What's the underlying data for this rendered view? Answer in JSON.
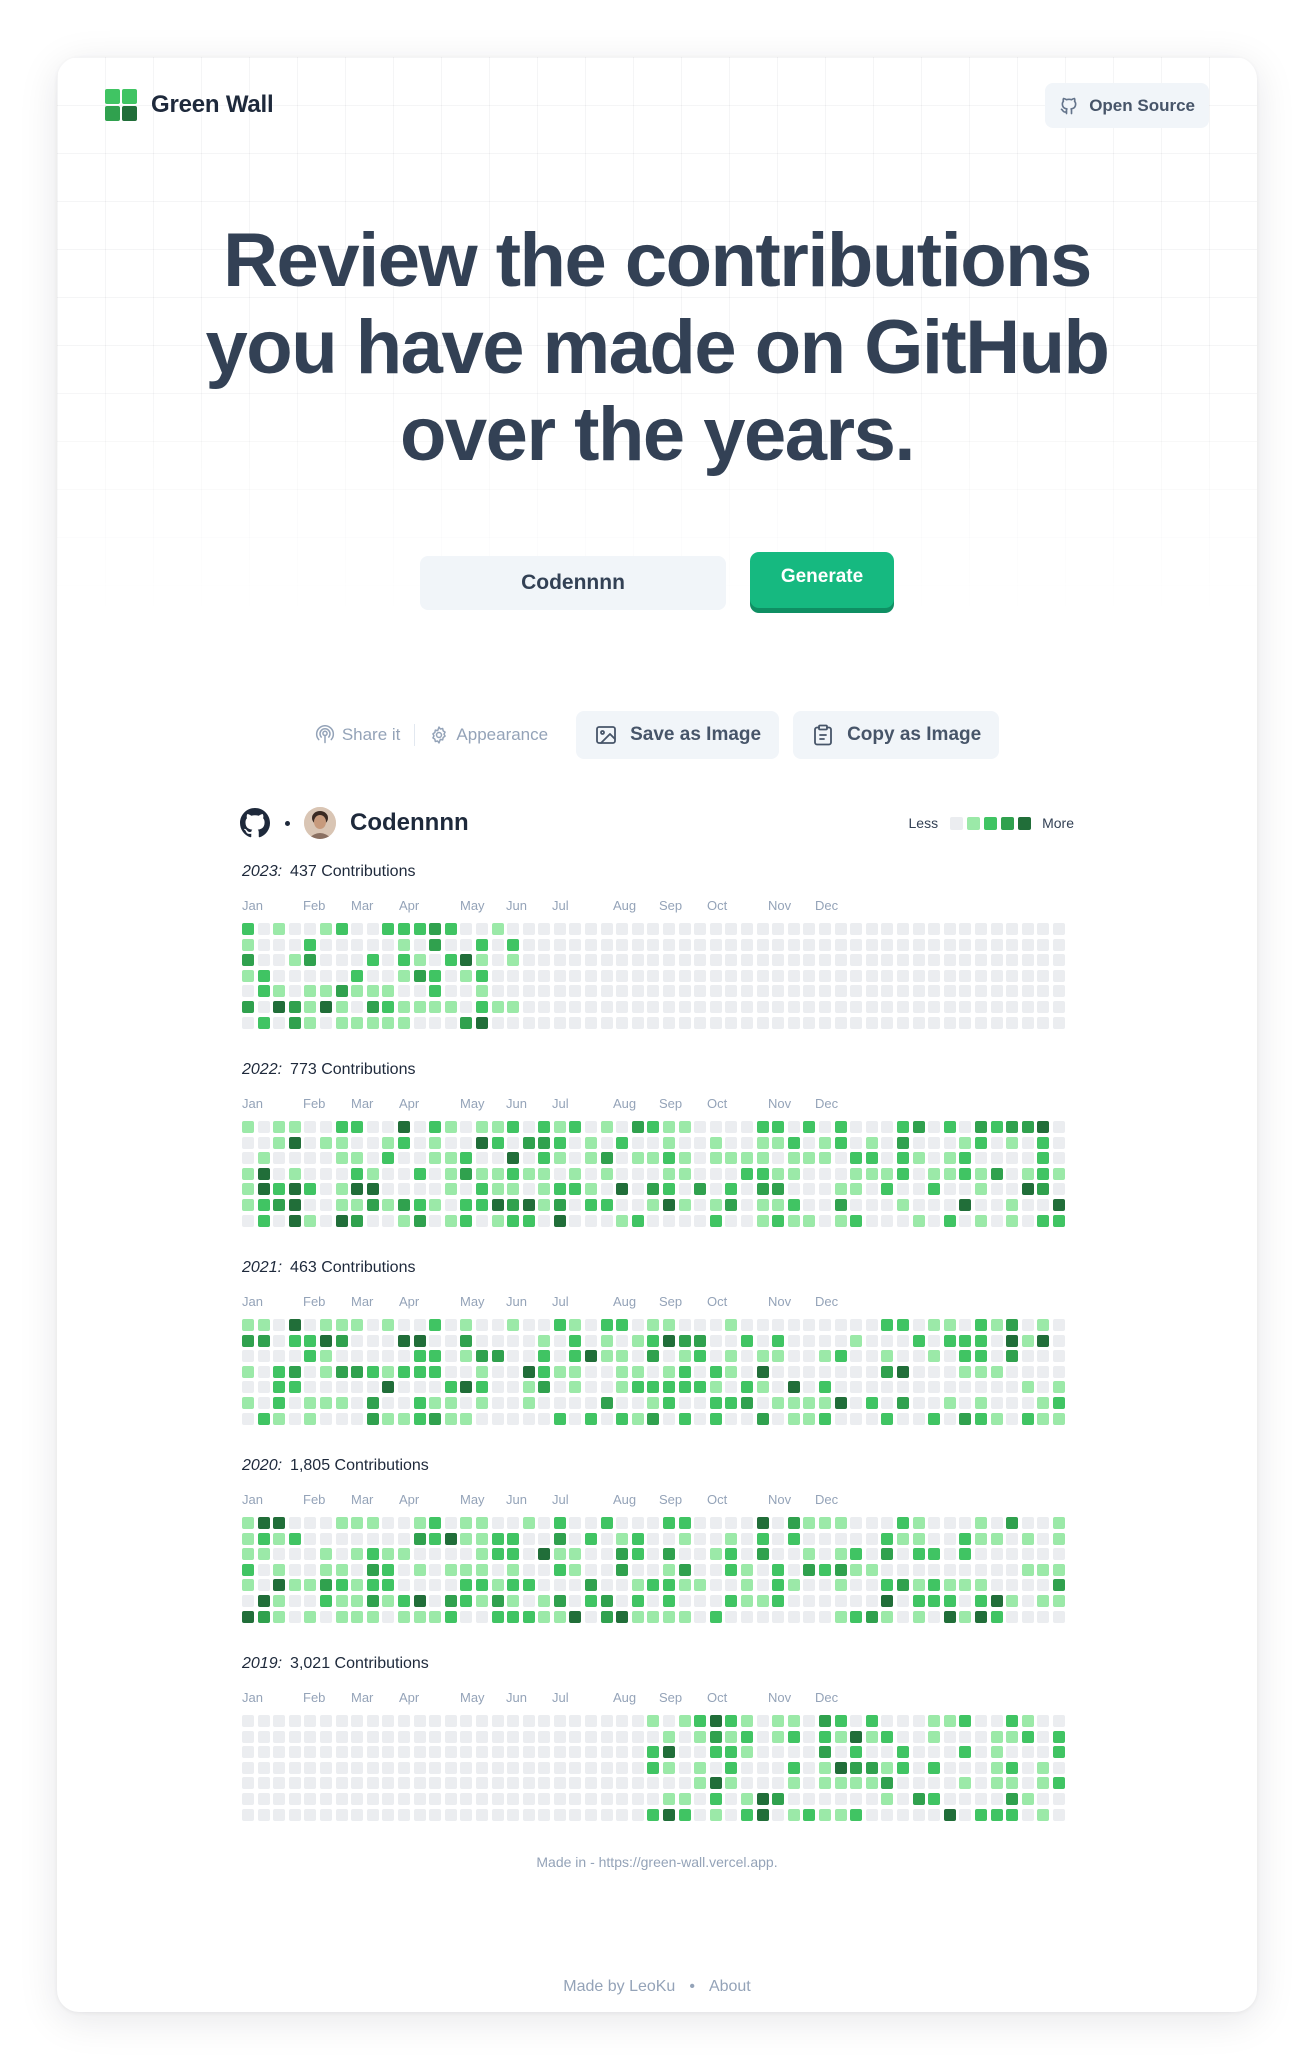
{
  "header": {
    "brand_name": "Green Wall",
    "open_source_label": "Open Source",
    "logo_colors": [
      "#40c463",
      "#40c463",
      "#30a14e",
      "#216e39"
    ]
  },
  "hero": {
    "line1": "Review the contributions",
    "line2": "you have made on GitHub",
    "line3": "over the years."
  },
  "search": {
    "username_value": "Codennnn",
    "generate_label": "Generate"
  },
  "toolbar": {
    "share_label": "Share it",
    "appearance_label": "Appearance",
    "save_label": "Save as Image",
    "copy_label": "Copy as Image"
  },
  "profile": {
    "username": "Codennnn"
  },
  "legend": {
    "less": "Less",
    "more": "More",
    "colors": [
      "#ebedf0",
      "#9be9a8",
      "#40c463",
      "#30a14e",
      "#216e39"
    ]
  },
  "months": [
    "Jan",
    "Feb",
    "Mar",
    "Apr",
    "May",
    "Jun",
    "Jul",
    "Aug",
    "Sep",
    "Oct",
    "Nov",
    "Dec"
  ],
  "years": [
    {
      "year": "2023:",
      "count": "437 Contributions",
      "active_start_week": 0,
      "active_end_week": 17
    },
    {
      "year": "2022:",
      "count": "773 Contributions",
      "active_start_week": 0,
      "active_end_week": 52
    },
    {
      "year": "2021:",
      "count": "463 Contributions",
      "active_start_week": 0,
      "active_end_week": 52
    },
    {
      "year": "2020:",
      "count": "1,805 Contributions",
      "active_start_week": 0,
      "active_end_week": 52
    },
    {
      "year": "2019:",
      "count": "3,021 Contributions",
      "active_start_week": 26,
      "active_end_week": 52
    }
  ],
  "made_in": "Made in - https://green-wall.vercel.app.",
  "footer": {
    "made_by": "Made by LeoKu",
    "separator": "•",
    "about": "About"
  }
}
